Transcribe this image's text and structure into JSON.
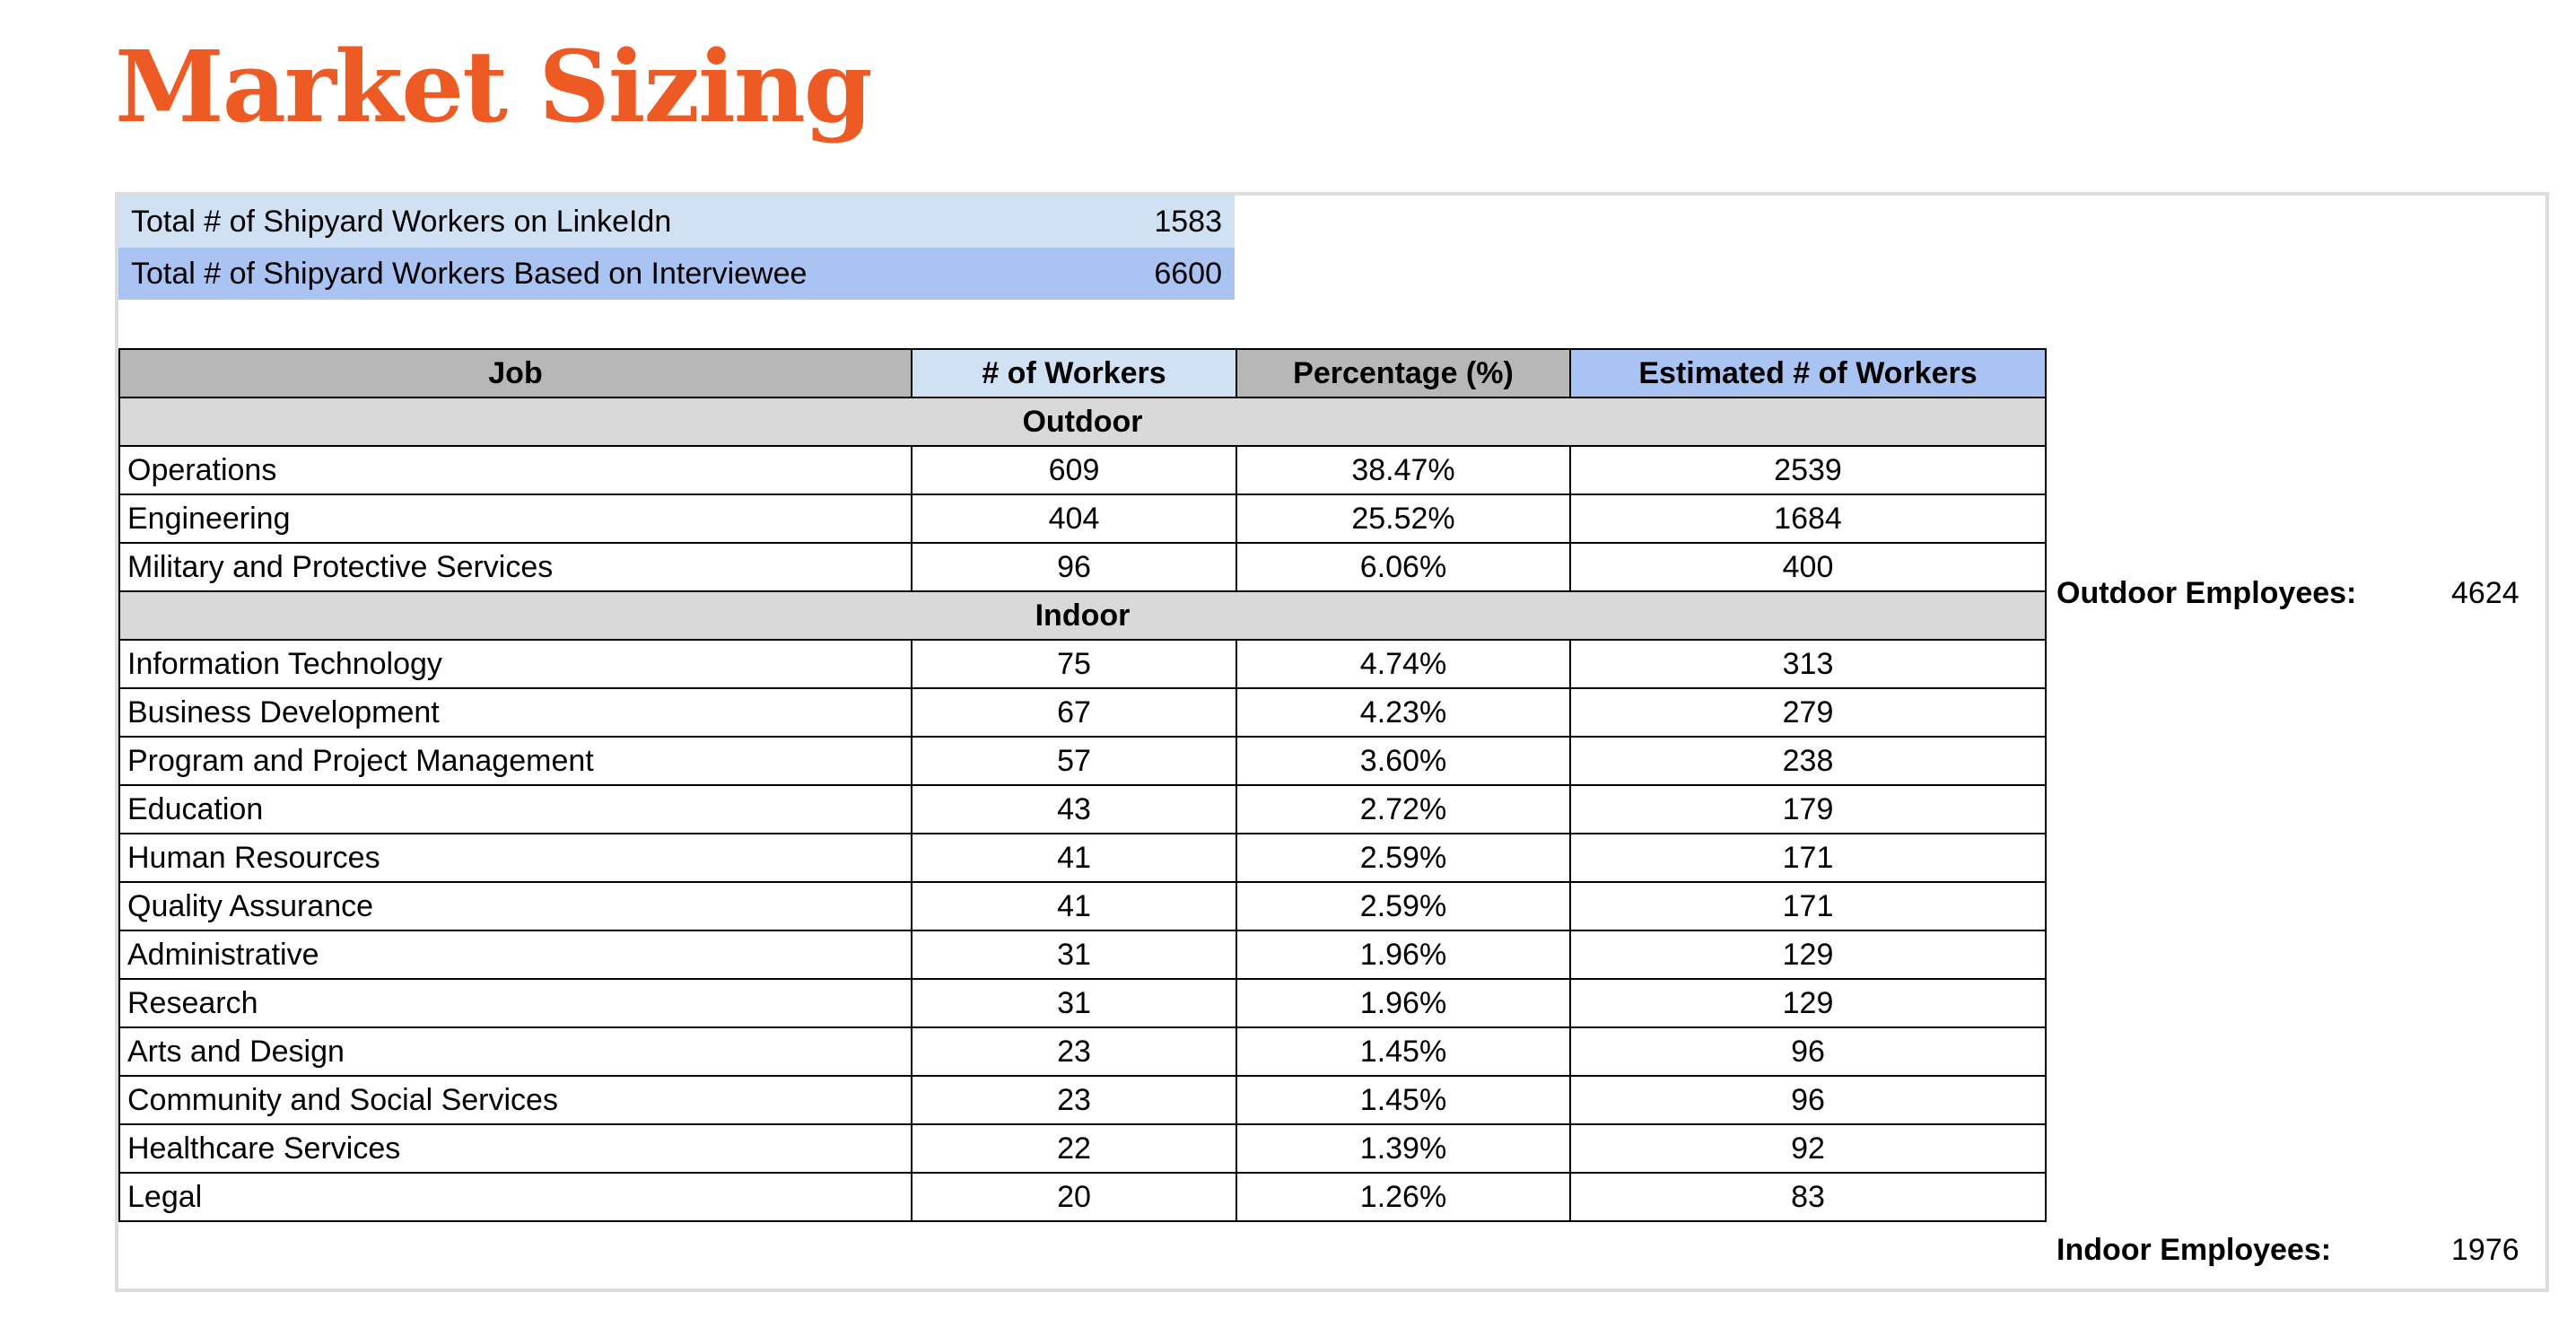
{
  "title": "Market Sizing",
  "summary": [
    {
      "label": "Total # of Shipyard Workers on LinkeIdn",
      "value": "1583"
    },
    {
      "label": "Total # of Shipyard Workers Based on Interviewee",
      "value": "6600"
    }
  ],
  "table": {
    "headers": {
      "job": "Job",
      "workers": "# of Workers",
      "percentage": "Percentage (%)",
      "estimated": "Estimated # of Workers"
    },
    "sections": [
      {
        "name": "Outdoor",
        "rows": [
          {
            "job": "Operations",
            "workers": "609",
            "percentage": "38.47%",
            "estimated": "2539"
          },
          {
            "job": "Engineering",
            "workers": "404",
            "percentage": "25.52%",
            "estimated": "1684"
          },
          {
            "job": "Military and Protective Services",
            "workers": "96",
            "percentage": "6.06%",
            "estimated": "400"
          }
        ]
      },
      {
        "name": "Indoor",
        "rows": [
          {
            "job": "Information Technology",
            "workers": "75",
            "percentage": "4.74%",
            "estimated": "313"
          },
          {
            "job": "Business Development",
            "workers": "67",
            "percentage": "4.23%",
            "estimated": "279"
          },
          {
            "job": "Program and Project Management",
            "workers": "57",
            "percentage": "3.60%",
            "estimated": "238"
          },
          {
            "job": "Education",
            "workers": "43",
            "percentage": "2.72%",
            "estimated": "179"
          },
          {
            "job": "Human Resources",
            "workers": "41",
            "percentage": "2.59%",
            "estimated": "171"
          },
          {
            "job": "Quality Assurance",
            "workers": "41",
            "percentage": "2.59%",
            "estimated": "171"
          },
          {
            "job": "Administrative",
            "workers": "31",
            "percentage": "1.96%",
            "estimated": "129"
          },
          {
            "job": "Research",
            "workers": "31",
            "percentage": "1.96%",
            "estimated": "129"
          },
          {
            "job": "Arts and Design",
            "workers": "23",
            "percentage": "1.45%",
            "estimated": "96"
          },
          {
            "job": "Community and Social Services",
            "workers": "23",
            "percentage": "1.45%",
            "estimated": "96"
          },
          {
            "job": "Healthcare Services",
            "workers": "22",
            "percentage": "1.39%",
            "estimated": "92"
          },
          {
            "job": "Legal",
            "workers": "20",
            "percentage": "1.26%",
            "estimated": "83"
          }
        ]
      }
    ]
  },
  "totals": {
    "outdoor": {
      "label": "Outdoor Employees:",
      "value": "4624"
    },
    "indoor": {
      "label": "Indoor Employees:",
      "value": "1976"
    }
  }
}
